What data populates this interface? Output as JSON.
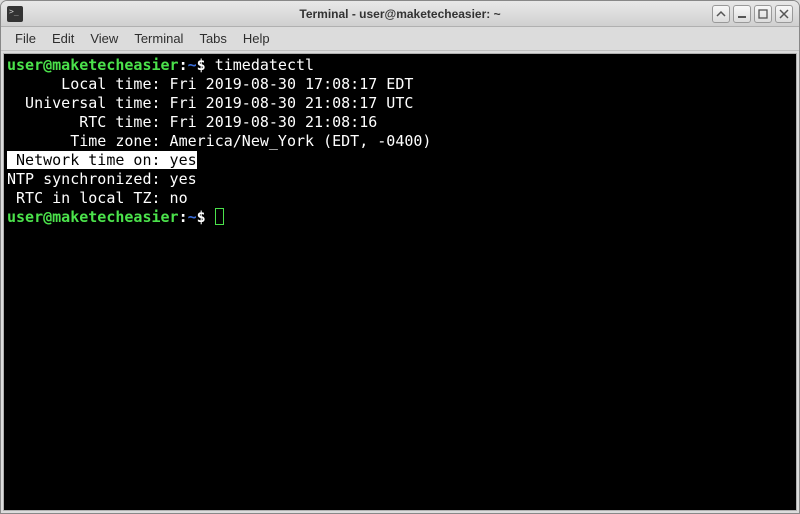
{
  "window": {
    "title": "Terminal - user@maketecheasier: ~"
  },
  "menu": {
    "file": "File",
    "edit": "Edit",
    "view": "View",
    "terminal": "Terminal",
    "tabs": "Tabs",
    "help": "Help"
  },
  "prompt": {
    "user_host": "user@maketecheasier",
    "sep": ":",
    "path": "~",
    "sym": "$"
  },
  "cmd1": "timedatectl",
  "output": {
    "local_label": "      Local time:",
    "local_value": " Fri 2019-08-30 17:08:17 EDT",
    "utc_label": "  Universal time:",
    "utc_value": " Fri 2019-08-30 21:08:17 UTC",
    "rtc_label": "        RTC time:",
    "rtc_value": " Fri 2019-08-30 21:08:16",
    "tz_label": "       Time zone:",
    "tz_value": " America/New_York (EDT, -0400)",
    "net_label": " Network time on:",
    "net_value": " yes",
    "ntp_label": "NTP synchronized:",
    "ntp_value": " yes",
    "rtctz_label": " RTC in local TZ:",
    "rtctz_value": " no"
  }
}
